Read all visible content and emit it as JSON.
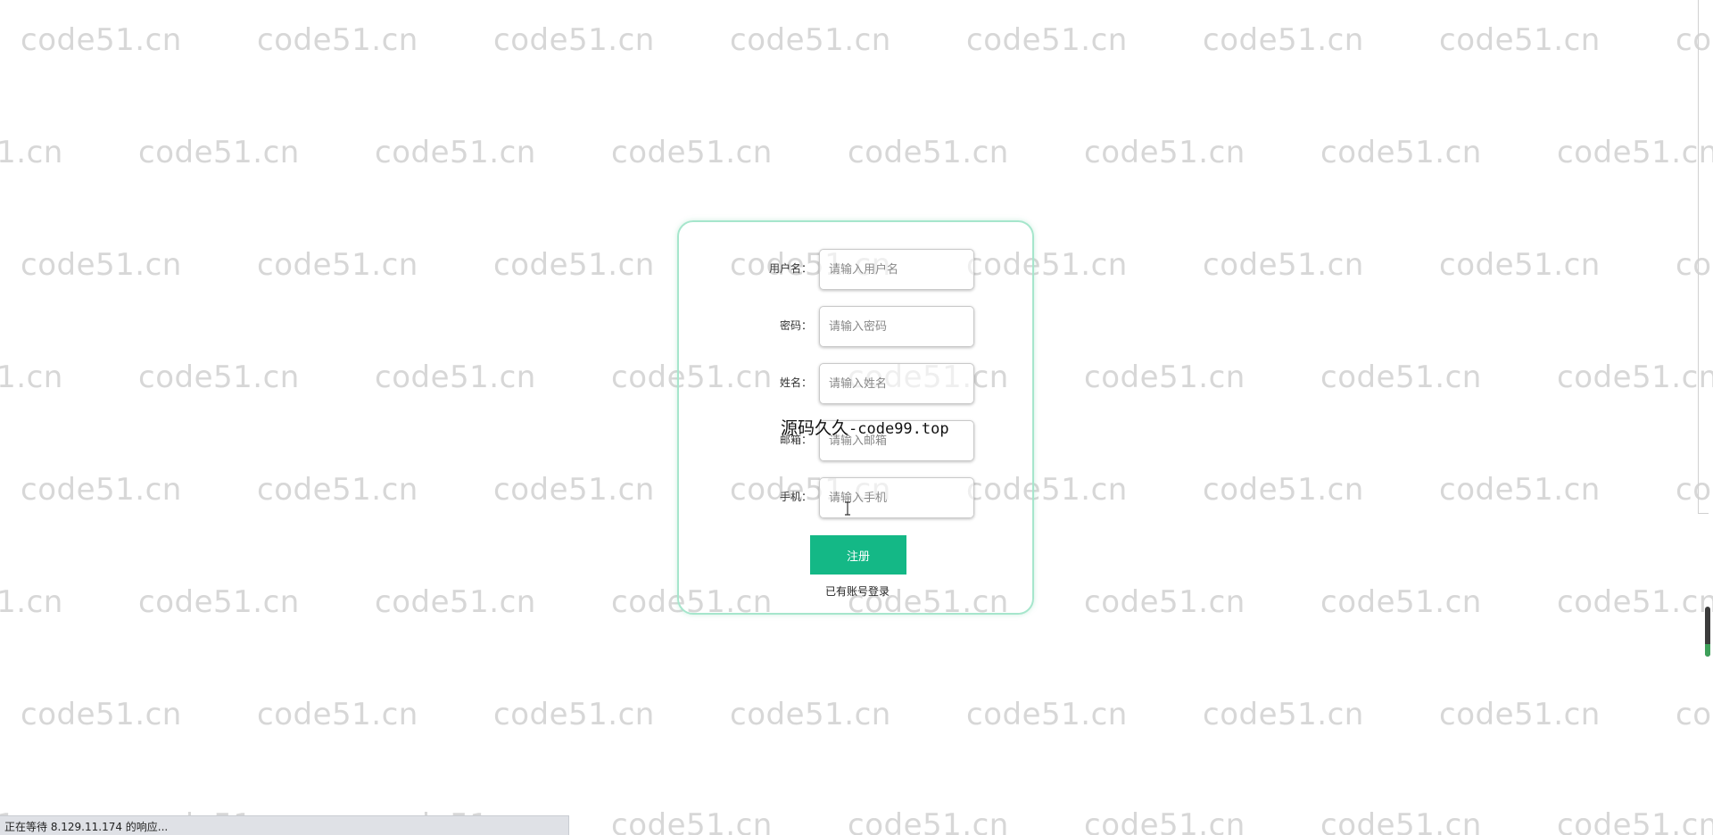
{
  "watermark_text": "code51.cn",
  "register_form": {
    "fields": [
      {
        "label": "用户名：",
        "placeholder": "请输入用户名",
        "value": ""
      },
      {
        "label": "密码：",
        "placeholder": "请输入密码",
        "value": ""
      },
      {
        "label": "姓名：",
        "placeholder": "请输入姓名",
        "value": ""
      },
      {
        "label": "邮箱：",
        "placeholder": "请输入邮箱",
        "value": ""
      },
      {
        "label": "手机：",
        "placeholder": "请输入手机",
        "value": ""
      }
    ],
    "register_label": "注册",
    "login_link": "已有账号登录"
  },
  "site_overlay": {
    "cn": "源码久久",
    "url": "-code99.top"
  },
  "status_bar": {
    "text": "正在等待 8.129.11.174 的响应..."
  },
  "colors": {
    "accent": "#14b886",
    "card_border": "#a6e6cc",
    "watermark": "#a0a0a0",
    "status_bar_bg": "#dfe1e6"
  },
  "icons": {
    "cursor": "text-cursor-icon"
  }
}
